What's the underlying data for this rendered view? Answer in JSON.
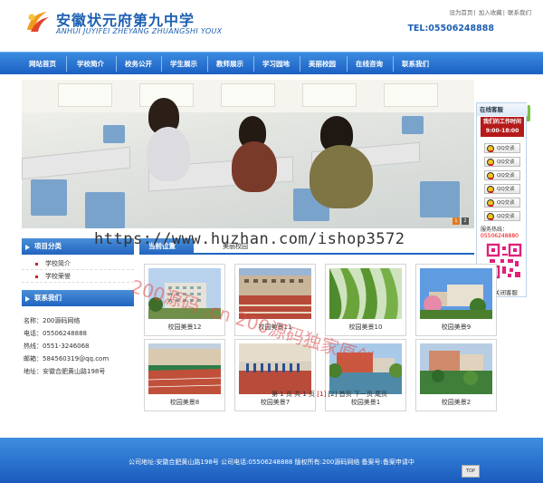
{
  "header": {
    "school_name": "安徽状元府第九中学",
    "school_name_en": "ANHUI JUYIFEI ZHEYANG ZHUANGSHI YOUX",
    "top_links": [
      "设为首页",
      "加入收藏",
      "联系我们"
    ],
    "phone": "TEL:05506248888"
  },
  "nav": {
    "items": [
      "网站首页",
      "学校简介",
      "校务公开",
      "学生展示",
      "教师展示",
      "学习园地",
      "美丽校园",
      "在线咨询",
      "联系我们"
    ]
  },
  "service": {
    "title": "在线客服",
    "hours_title": "我们的工作时间",
    "hours": "9:00-18:00",
    "qq_buttons": [
      "QQ交谈",
      "QQ交谈",
      "QQ交谈",
      "QQ交谈",
      "QQ交谈",
      "QQ交谈"
    ],
    "hotline_label": "服务热线：",
    "hotline": "05506248880",
    "close": "关闭客服"
  },
  "sidebar": {
    "category_title": "项目分类",
    "categories": [
      "学校简介",
      "学校荣誉"
    ],
    "contact_title": "联系我们",
    "contact": {
      "name": "名称：200源码网络",
      "phone": "电话：05506248888",
      "hotline": "热线：0551-3246068",
      "email": "邮箱：584560319@qq.com",
      "address": "地址：安徽合肥黄山路198号"
    }
  },
  "main": {
    "tab": "当前位置",
    "breadcrumb": "美丽校园",
    "gallery": [
      {
        "caption": "校园美景12"
      },
      {
        "caption": "校园美景11"
      },
      {
        "caption": "校园美景10"
      },
      {
        "caption": "校园美景9"
      },
      {
        "caption": "校园美景8"
      },
      {
        "caption": "校园美景7"
      },
      {
        "caption": "校园美景1"
      },
      {
        "caption": "校园美景2"
      }
    ],
    "pager": {
      "summary": "第 1 页 共 1 页",
      "current": "[1]",
      "page2": "[2]",
      "first": "首页",
      "next": "下一页",
      "last": "尾页"
    }
  },
  "footer": {
    "text": "公司地址:安徽合肥黄山路198号 公司电话:05506248888 版权所有:200源码网络 备案号:备案申请中",
    "top_button": "TOP"
  },
  "watermark": {
    "url": "https://www.huzhan.com/ishop3572",
    "diag": "200源码 .cn 200源码独家原创"
  },
  "colors": {
    "nav_blue": "#2164c0",
    "title_blue": "#1d5fb2",
    "service_red": "#b51a1a",
    "accent_green": "#7ac143"
  }
}
